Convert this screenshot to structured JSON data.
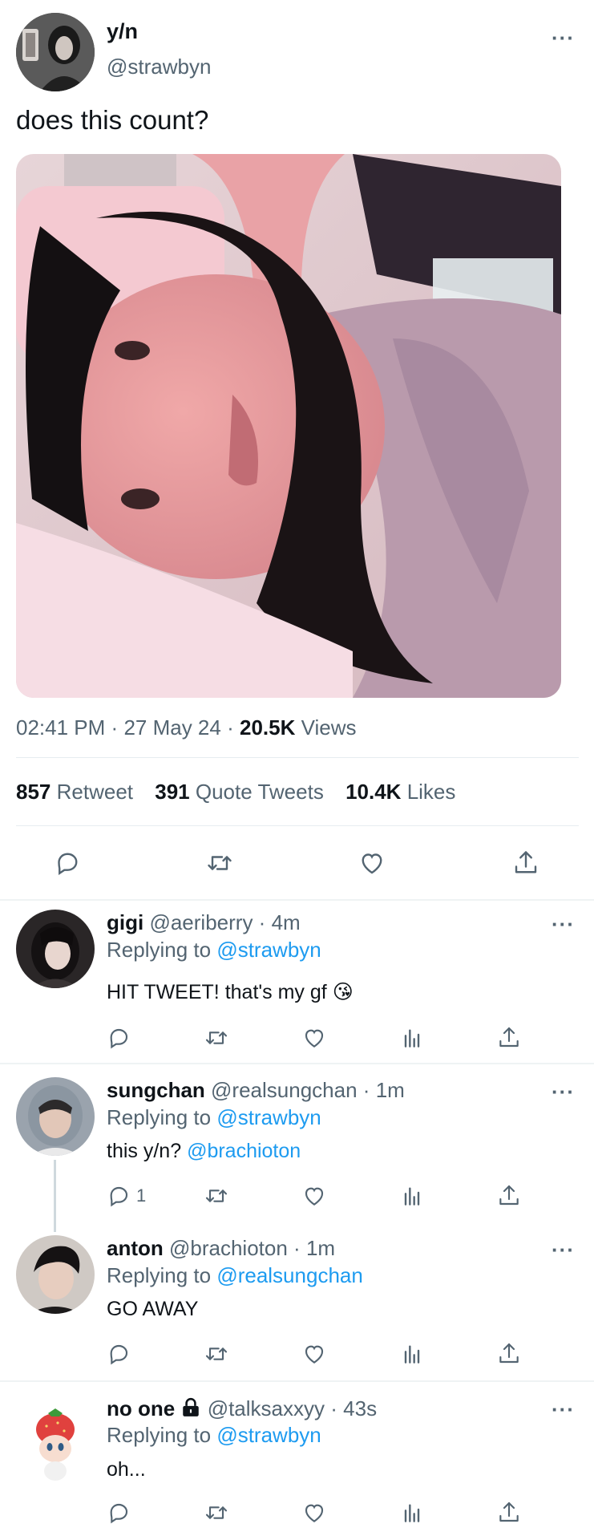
{
  "tweet": {
    "name": "y/n",
    "handle": "@strawbyn",
    "text": "does this count?",
    "time": "02:41 PM",
    "date": "27 May 24",
    "views_count": "20.5K",
    "views_label": "Views",
    "separator": "·",
    "retweets_count": "857",
    "retweets_label": "Retweet",
    "quotes_count": "391",
    "quotes_label": "Quote Tweets",
    "likes_count": "10.4K",
    "likes_label": "Likes"
  },
  "replies": [
    {
      "name": "gigi",
      "handle": "@aeriberry",
      "time": "4m",
      "replying_label": "Replying to",
      "replying_to": "@strawbyn",
      "text": "HIT TWEET! that's my gf",
      "emoji": "😘",
      "reply_count": ""
    },
    {
      "name": "sungchan",
      "handle": "@realsungchan",
      "time": "1m",
      "replying_label": "Replying to",
      "replying_to": "@strawbyn",
      "text": "this y/n?",
      "mention": "@brachioton",
      "reply_count": "1"
    },
    {
      "name": "anton",
      "handle": "@brachioton",
      "time": "1m",
      "replying_label": "Replying to",
      "replying_to": "@realsungchan",
      "text": "GO AWAY",
      "reply_count": ""
    },
    {
      "name": "no one",
      "handle": "@talksaxxyy",
      "time": "43s",
      "replying_label": "Replying to",
      "replying_to": "@strawbyn",
      "text": "oh...",
      "reply_count": ""
    }
  ],
  "colors": {
    "accent": "#1d9bf0",
    "muted": "#536471",
    "text": "#0f1419"
  }
}
